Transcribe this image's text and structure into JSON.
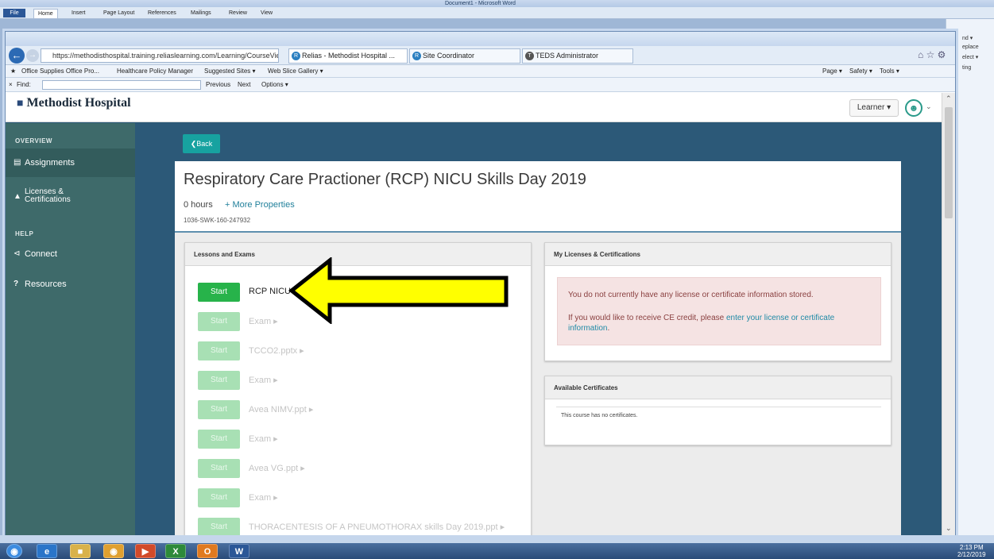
{
  "word": {
    "title": "Document1 - Microsoft Word",
    "tabs": [
      "File",
      "Home",
      "Insert",
      "Page Layout",
      "References",
      "Mailings",
      "Review",
      "View"
    ],
    "right_pane": [
      "nd ▾",
      "eplace",
      "elect ▾",
      "ting"
    ]
  },
  "browser": {
    "url": "https://methodisthospital.training.reliaslearning.com/Learning/CourseViewer.a",
    "tabs": [
      {
        "label": "Relias - Methodist Hospital ...",
        "active": true
      },
      {
        "label": "Site Coordinator",
        "active": false
      },
      {
        "label": "TEDS Administrator",
        "active": false
      }
    ],
    "favorites": [
      "Office Supplies Office Pro...",
      "Healthcare Policy Manager",
      "Suggested Sites ▾",
      "Web Slice Gallery ▾"
    ],
    "right_tools": [
      "Page ▾",
      "Safety ▾",
      "Tools ▾"
    ],
    "find": {
      "label": "Find:",
      "previous": "Previous",
      "next": "Next",
      "options": "Options ▾"
    }
  },
  "header": {
    "brand": "Methodist Hospital",
    "learner": "Learner ▾"
  },
  "sidebar": {
    "overview": "OVERVIEW",
    "help": "HELP",
    "items": [
      {
        "label": "Assignments",
        "icon": "document-icon"
      },
      {
        "label": "Licenses & Certifications",
        "icon": "graduation-cap-icon"
      },
      {
        "label": "Connect",
        "icon": "share-icon"
      },
      {
        "label": "Resources",
        "icon": "question-icon"
      }
    ]
  },
  "back_label": "Back",
  "course": {
    "title": "Respiratory Care Practioner (RCP) NICU Skills Day 2019",
    "hours": "0 hours",
    "more": "+ More Properties",
    "code": "1036-SWK-160-247932"
  },
  "lessons": {
    "header": "Lessons and Exams",
    "start_label": "Start",
    "items": [
      {
        "name": "RCP NICU P",
        "enabled": true
      },
      {
        "name": "Exam ▸",
        "enabled": false
      },
      {
        "name": "TCCO2.pptx ▸",
        "enabled": false
      },
      {
        "name": "Exam ▸",
        "enabled": false
      },
      {
        "name": "Avea NIMV.ppt ▸",
        "enabled": false
      },
      {
        "name": "Exam ▸",
        "enabled": false
      },
      {
        "name": "Avea VG.ppt ▸",
        "enabled": false
      },
      {
        "name": "Exam ▸",
        "enabled": false
      },
      {
        "name": "THORACENTESIS OF A PNEUMOTHORAX skills Day 2019.ppt ▸",
        "enabled": false
      }
    ]
  },
  "licenses": {
    "header": "My Licenses & Certifications",
    "msg1": "You do not currently have any license or certificate information stored.",
    "msg2": "If you would like to receive CE credit, please",
    "link1": "enter your license or certificate",
    "link2": "information",
    "period": "."
  },
  "certs": {
    "header": "Available Certificates",
    "empty": "This course has no certificates."
  },
  "clock": {
    "time": "2:13 PM",
    "date": "2/12/2019"
  },
  "colors": {
    "sidebar": "#3e6a6a",
    "page_bg": "#2c5978",
    "start_green": "#27b34a",
    "teal": "#17a2a0",
    "arrow": "#ffff00"
  }
}
